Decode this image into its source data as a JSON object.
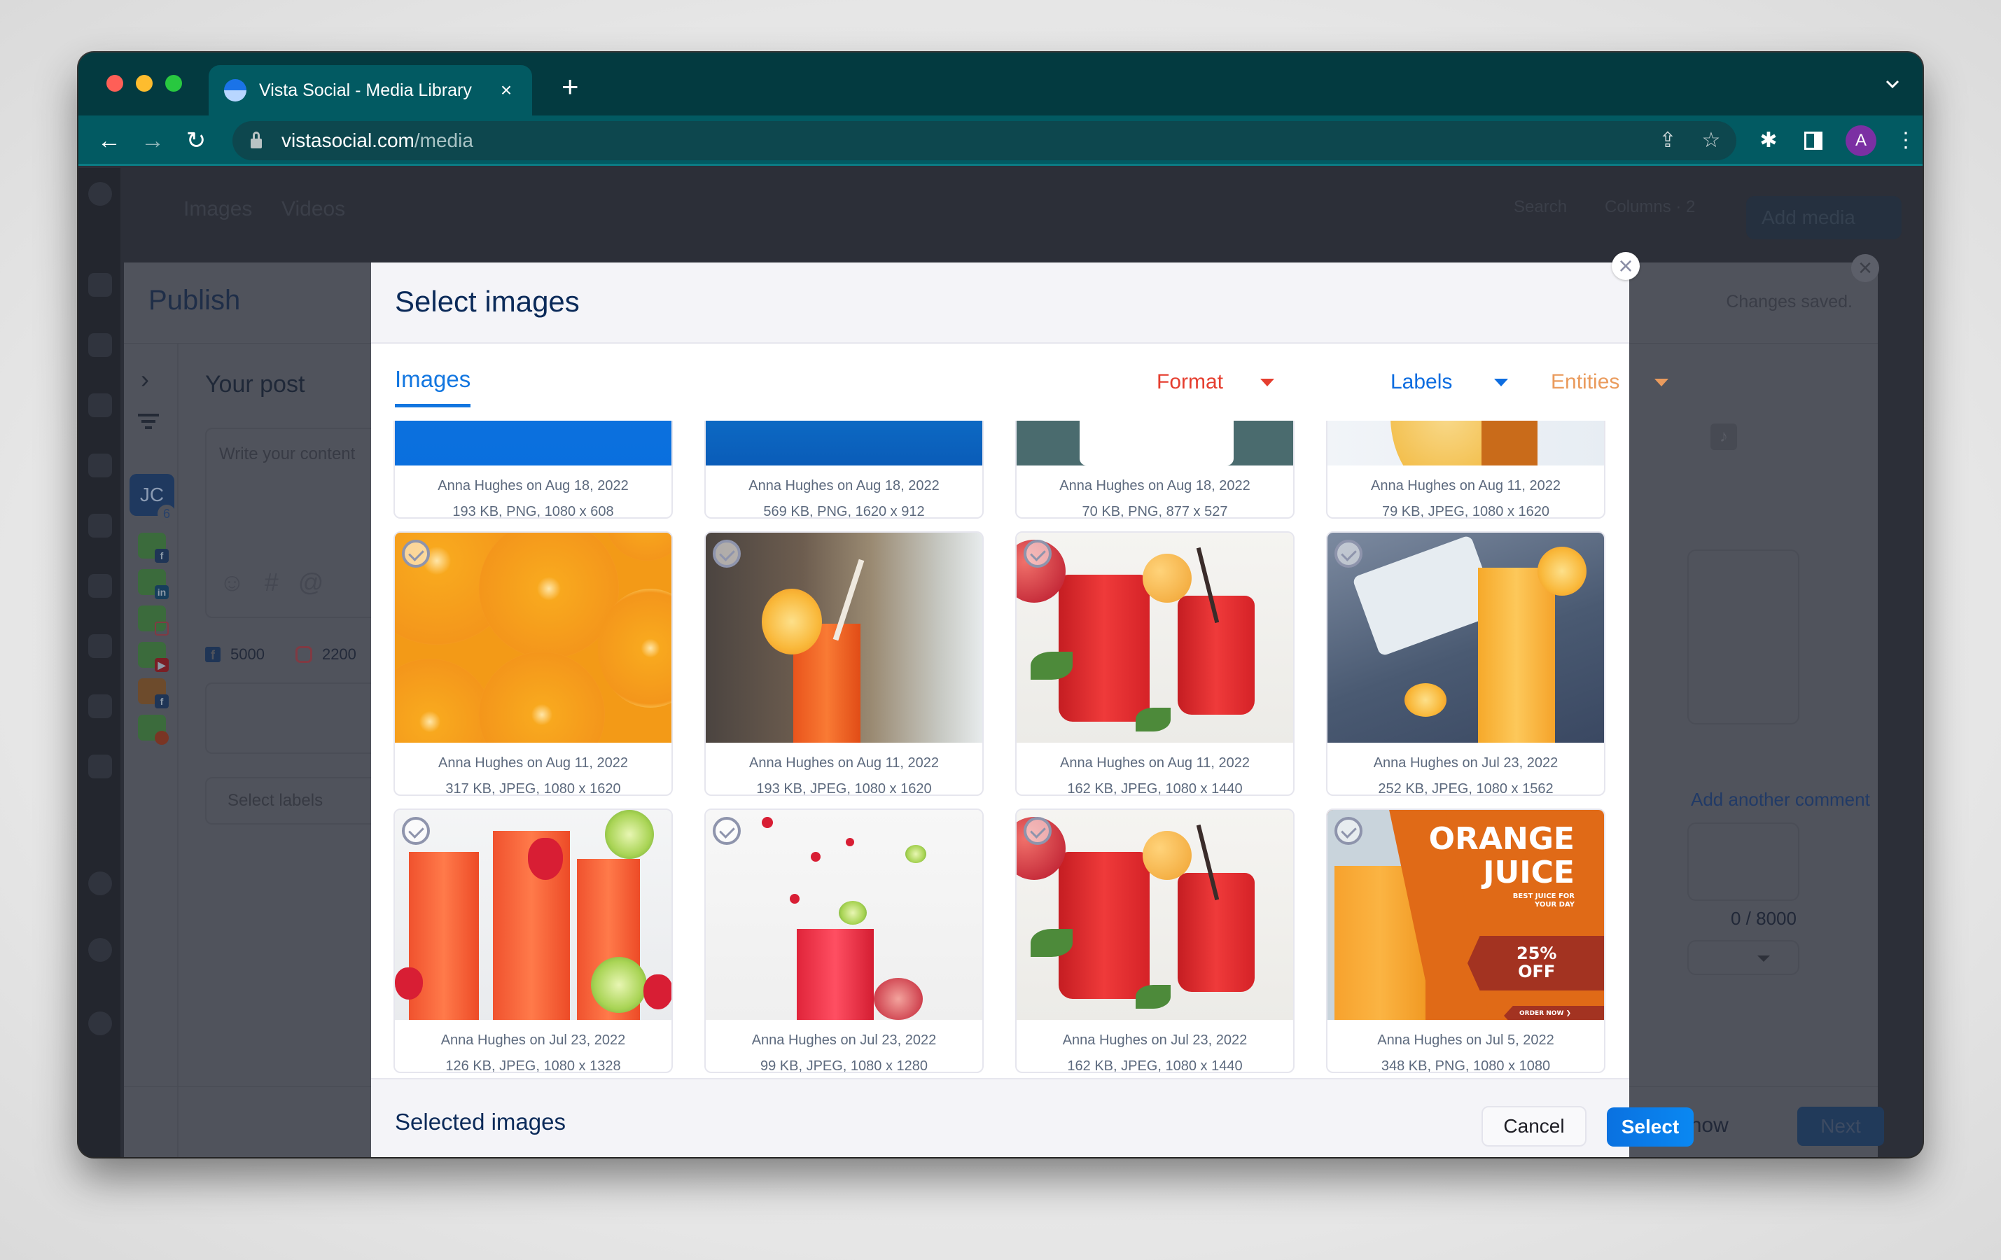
{
  "browser": {
    "tab_title": "Vista Social - Media Library",
    "tab_close": "×",
    "new_tab": "+",
    "url_host": "vistasocial.com",
    "url_path": "/media",
    "profile_initial": "A"
  },
  "background_page": {
    "topbar_items": [
      "Images",
      "Videos"
    ],
    "search_label": "Search",
    "columns_label": "Columns · 2",
    "add_media": "Add media",
    "bottom_cards": [
      {
        "meta1": "Anna Hughes on Aug 18, 2022",
        "meta2": "70 KB, PNG, 877 x 527"
      },
      {
        "meta1": "Anna Hughes on Aug 11, 2022",
        "meta2": "317 KB, JPEG, 1080 x 1620"
      }
    ]
  },
  "publish": {
    "title": "Publish",
    "status": "Changes saved.",
    "your_post": "Your post",
    "content_placeholder": "Write your content",
    "profile_initials": "JC",
    "profile_count": "6",
    "accounts": [
      "facebook",
      "linkedin",
      "instagram",
      "youtube",
      "facebook",
      "reddit"
    ],
    "char_counts": [
      {
        "network": "facebook",
        "value": "5000"
      },
      {
        "network": "instagram",
        "value": "2200"
      }
    ],
    "labels_placeholder": "Select labels",
    "comment_link": "Add another comment",
    "comment_counter": "0 / 8000",
    "publish_now": "Publish now",
    "next": "Next"
  },
  "modal": {
    "title": "Select images",
    "close": "×",
    "tab_images": "Images",
    "filters": [
      {
        "label": "Format",
        "color": "#e53e2f"
      },
      {
        "label": "Labels",
        "color": "#0e6de0"
      },
      {
        "label": "Entities",
        "color": "#ea9b5d"
      }
    ],
    "images": [
      {
        "art": "blue",
        "meta1": "Anna Hughes on Aug 18, 2022",
        "meta2": "193 KB, PNG, 1080 x 608"
      },
      {
        "art": "blue2",
        "meta1": "Anna Hughes on Aug 18, 2022",
        "meta2": "569 KB, PNG, 1620 x 912"
      },
      {
        "art": "teal",
        "meta1": "Anna Hughes on Aug 18, 2022",
        "meta2": "70 KB, PNG, 877 x 527"
      },
      {
        "art": "lemon",
        "meta1": "Anna Hughes on Aug 11, 2022",
        "meta2": "79 KB, JPEG, 1080 x 1620"
      },
      {
        "art": "oranges",
        "meta1": "Anna Hughes on Aug 11, 2022",
        "meta2": "317 KB, JPEG, 1080 x 1620"
      },
      {
        "art": "cafe",
        "meta1": "Anna Hughes on Aug 11, 2022",
        "meta2": "193 KB, JPEG, 1080 x 1620"
      },
      {
        "art": "redjuice",
        "meta1": "Anna Hughes on Aug 11, 2022",
        "meta2": "162 KB, JPEG, 1080 x 1440"
      },
      {
        "art": "ojglass",
        "meta1": "Anna Hughes on Jul 23, 2022",
        "meta2": "252 KB, JPEG, 1080 x 1562"
      },
      {
        "art": "lemonade",
        "meta1": "Anna Hughes on Jul 23, 2022",
        "meta2": "126 KB, JPEG, 1080 x 1328"
      },
      {
        "art": "splash",
        "meta1": "Anna Hughes on Jul 23, 2022",
        "meta2": "99 KB, JPEG, 1080 x 1280"
      },
      {
        "art": "redjuice",
        "meta1": "Anna Hughes on Jul 23, 2022",
        "meta2": "162 KB, JPEG, 1080 x 1440"
      },
      {
        "art": "ojad",
        "meta1": "Anna Hughes on Jul 5, 2022",
        "meta2": "348 KB, PNG, 1080 x 1080"
      }
    ],
    "ad_text": {
      "title_line1": "ORANGE",
      "title_line2": "JUICE",
      "sub_line1": "BEST JUICE FOR",
      "sub_line2": "YOUR DAY",
      "discount_line1": "25%",
      "discount_line2": "OFF",
      "cta": "ORDER NOW"
    },
    "selected_label": "Selected images",
    "cancel": "Cancel",
    "select": "Select"
  }
}
